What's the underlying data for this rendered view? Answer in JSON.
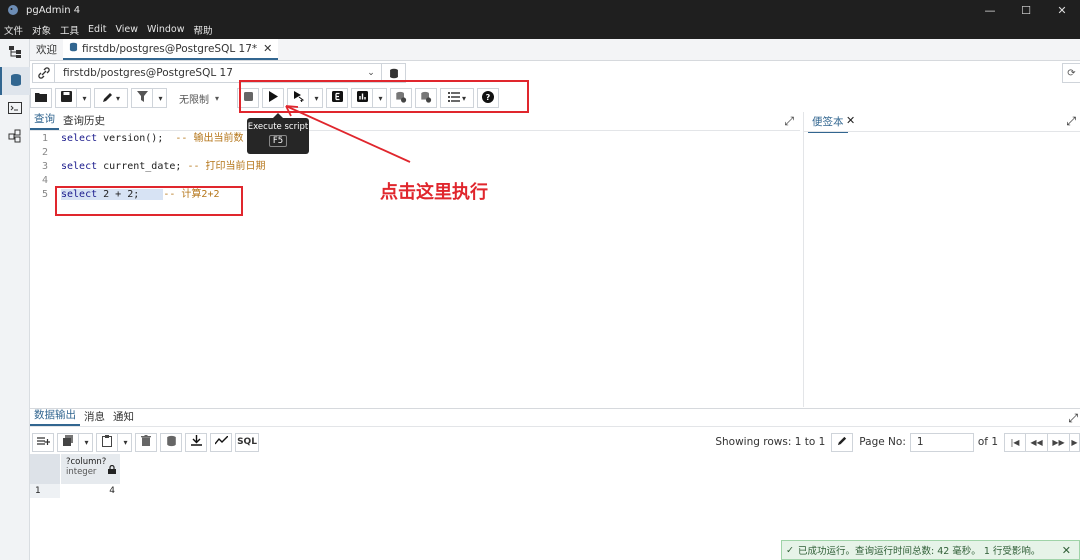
{
  "window": {
    "title": "pgAdmin 4",
    "controls": [
      "—",
      "☐",
      "✕"
    ]
  },
  "menu": [
    "文件",
    "对象",
    "工具",
    "Edit",
    "View",
    "Window",
    "帮助"
  ],
  "tabs": [
    {
      "label": "欢迎"
    },
    {
      "label": "firstdb/postgres@PostgreSQL 17*",
      "close": "✕"
    }
  ],
  "connection": {
    "value": "firstdb/postgres@PostgreSQL 17",
    "dropdown": "⌄"
  },
  "toolbar": {
    "limit_label": "无限制"
  },
  "tooltip": {
    "title": "Execute script",
    "key": "F5"
  },
  "editor": {
    "tabs": [
      "查询",
      "查询历史"
    ],
    "lines": [
      {
        "n": "1",
        "kw": "select",
        "rest": " version();  ",
        "comment": "-- 输出当前数"
      },
      {
        "n": "2",
        "kw": "",
        "rest": "",
        "comment": ""
      },
      {
        "n": "3",
        "kw": "select",
        "rest": " current_date; ",
        "comment": "-- 打印当前日期"
      },
      {
        "n": "4",
        "kw": "",
        "rest": "",
        "comment": ""
      },
      {
        "n": "5",
        "kw": "select",
        "rest": " 2 + 2;    ",
        "comment": "-- 计算2+2"
      }
    ]
  },
  "notes": {
    "title": "便签本",
    "close": "✕"
  },
  "annotation": {
    "text": "点击这里执行"
  },
  "results": {
    "tabs": [
      "数据输出",
      "消息",
      "通知"
    ],
    "showing": "Showing rows: 1 to 1",
    "page_label": "Page No:",
    "page_value": "1",
    "of_label": "of 1",
    "sql_label": "SQL",
    "column": {
      "name": "?column?",
      "type": "integer"
    },
    "rows": [
      {
        "n": "1",
        "value": "4"
      }
    ]
  },
  "toast": {
    "message": "已成功运行。查询运行时间总数: 42 毫秒。 1 行受影响。",
    "close": "✕"
  }
}
